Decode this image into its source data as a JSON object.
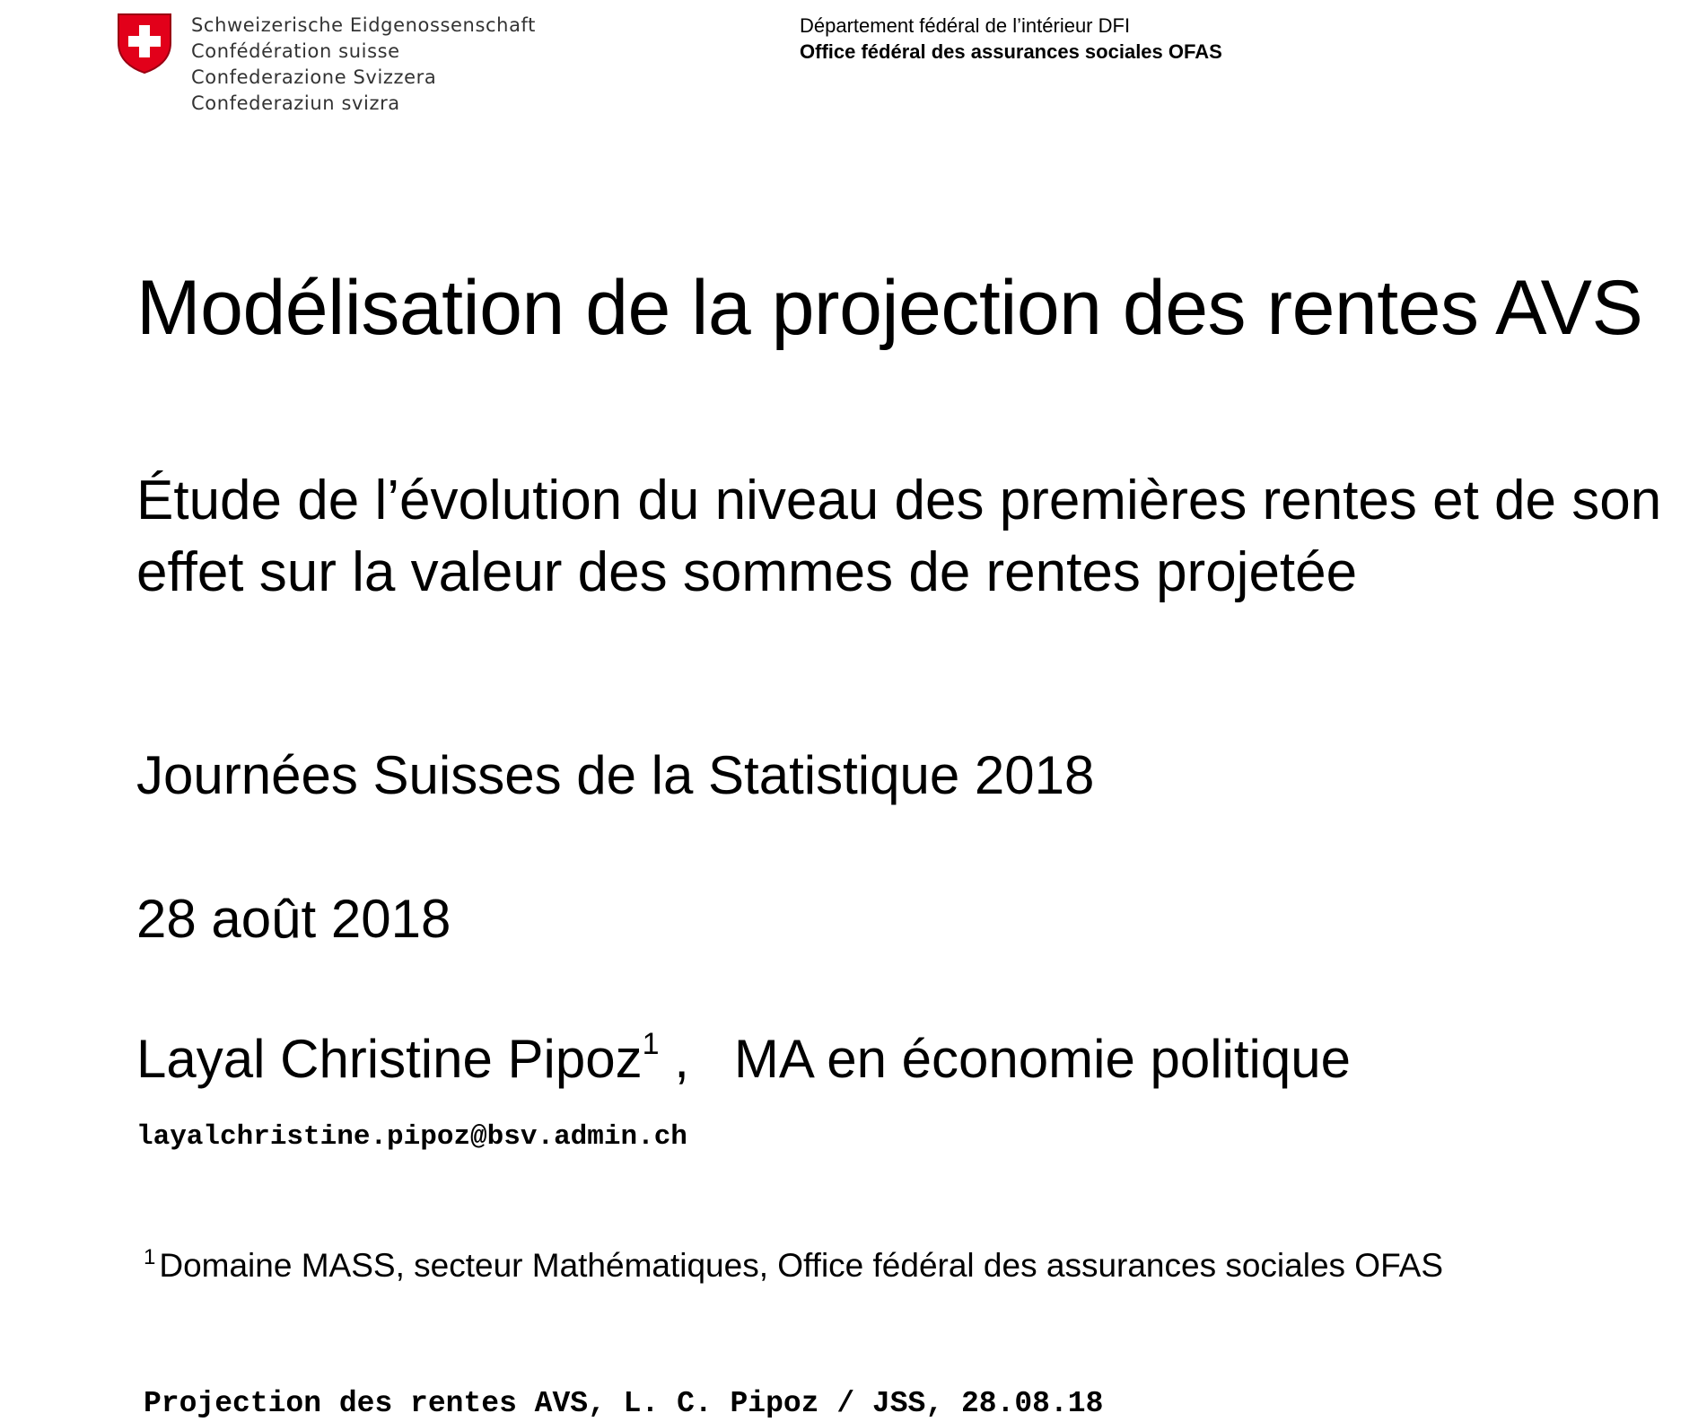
{
  "header": {
    "confederation_lines": [
      "Schweizerische Eidgenossenschaft",
      "Confédération suisse",
      "Confederazione Svizzera",
      "Confederaziun svizra"
    ],
    "department": "Département fédéral de l’intérieur DFI",
    "office": "Office fédéral des assurances sociales OFAS",
    "logo_icon": "swiss-coat-of-arms",
    "logo_color": "#E2001A"
  },
  "title": {
    "main": "Modélisation de la projection des rentes AVS",
    "subtitle": "Étude de l’évolution du niveau des premières rentes et de son effet sur la valeur des sommes de rentes projetée"
  },
  "event": "Journées Suisses de la Statistique 2018",
  "date": "28 août 2018",
  "author": {
    "name": "Layal Christine Pipoz",
    "affiliation_mark": "1",
    "separator": ",",
    "degree": "MA en économie politique",
    "email": "layalchristine.pipoz@bsv.admin.ch"
  },
  "footnote": {
    "mark": "1",
    "text": "Domaine MASS, secteur Mathématiques, Office fédéral des assurances sociales OFAS"
  },
  "footer": "Projection des rentes AVS, L. C. Pipoz / JSS, 28.08.18"
}
